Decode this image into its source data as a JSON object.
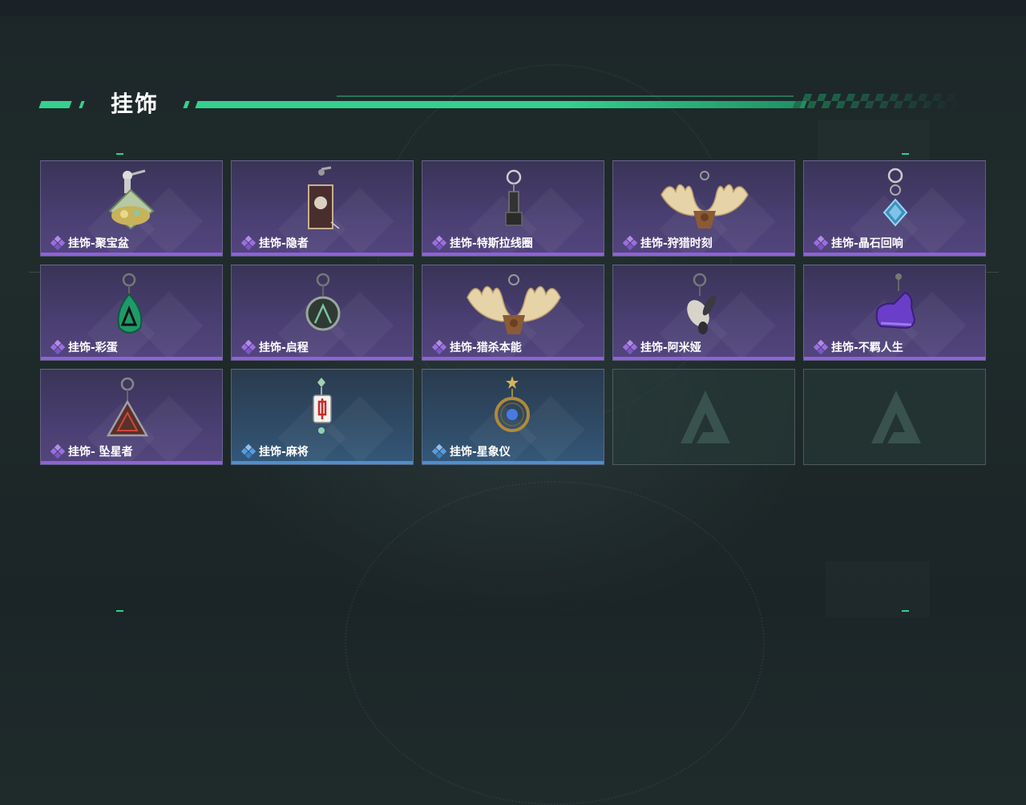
{
  "header": {
    "title": "挂饰"
  },
  "colors": {
    "accent": "#35d08f",
    "purple_rarity": "#8e63d6",
    "blue_rarity": "#4d8fcf"
  },
  "items": [
    {
      "label": "挂饰-聚宝盆",
      "rarity": "purple",
      "icon": "treasure-bowl-charm-icon"
    },
    {
      "label": "挂饰-隐者",
      "rarity": "purple",
      "icon": "hermit-card-charm-icon"
    },
    {
      "label": "挂饰-特斯拉线圈",
      "rarity": "purple",
      "icon": "tesla-coil-charm-icon"
    },
    {
      "label": "挂饰-狩猎时刻",
      "rarity": "purple",
      "icon": "moose-antlers-charm-icon"
    },
    {
      "label": "挂饰-晶石回响",
      "rarity": "purple",
      "icon": "crystal-charm-icon"
    },
    {
      "label": "挂饰-彩蛋",
      "rarity": "purple",
      "icon": "easter-egg-charm-icon"
    },
    {
      "label": "挂饰-启程",
      "rarity": "purple",
      "icon": "departure-medal-charm-icon"
    },
    {
      "label": "挂饰-猎杀本能",
      "rarity": "purple",
      "icon": "moose-antlers-charm-icon"
    },
    {
      "label": "挂饰-阿米娅",
      "rarity": "purple",
      "icon": "bunny-charm-icon"
    },
    {
      "label": "挂饰-不羁人生",
      "rarity": "purple",
      "icon": "sneaker-charm-icon"
    },
    {
      "label": "挂饰- 坠星者",
      "rarity": "purple",
      "icon": "triangle-emblem-charm-icon"
    },
    {
      "label": "挂饰-麻将",
      "rarity": "blue",
      "icon": "mahjong-tile-charm-icon"
    },
    {
      "label": "挂饰-星象仪",
      "rarity": "blue",
      "icon": "astrolabe-charm-icon"
    }
  ],
  "empty_slots": [
    {
      "icon": "delta-logo-icon"
    },
    {
      "icon": "delta-logo-icon"
    }
  ]
}
